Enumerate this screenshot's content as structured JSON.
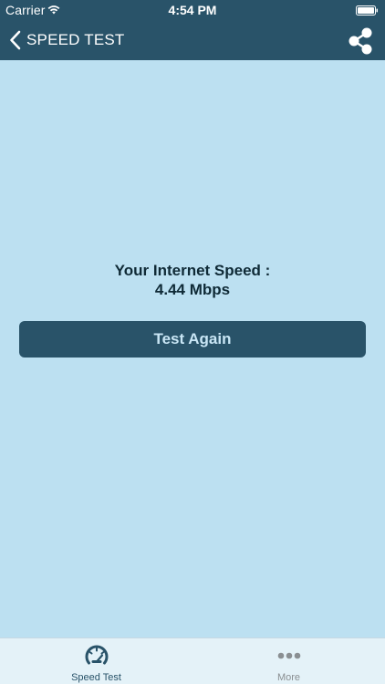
{
  "status_bar": {
    "carrier": "Carrier",
    "time": "4:54 PM",
    "icons": [
      "wifi-icon",
      "battery-icon"
    ]
  },
  "nav_bar": {
    "title": "SPEED TEST",
    "icons": [
      "chevron-left-icon",
      "share-icon"
    ]
  },
  "main": {
    "speed_label": "Your Internet Speed :",
    "speed_value": "4.44 Mbps",
    "test_again_label": "Test Again"
  },
  "tab_bar": {
    "tabs": [
      {
        "label": "Speed Test",
        "icon": "speedometer-icon",
        "active": true
      },
      {
        "label": "More",
        "icon": "more-dots-icon",
        "active": false
      }
    ]
  },
  "colors": {
    "header_bg": "#295369",
    "content_bg": "#BCE0F1",
    "button_bg": "#295369",
    "button_text": "#C9E6F5",
    "tab_bar_bg": "#E4F2F8",
    "tab_active": "#295369",
    "tab_inactive": "#8a8f92"
  }
}
